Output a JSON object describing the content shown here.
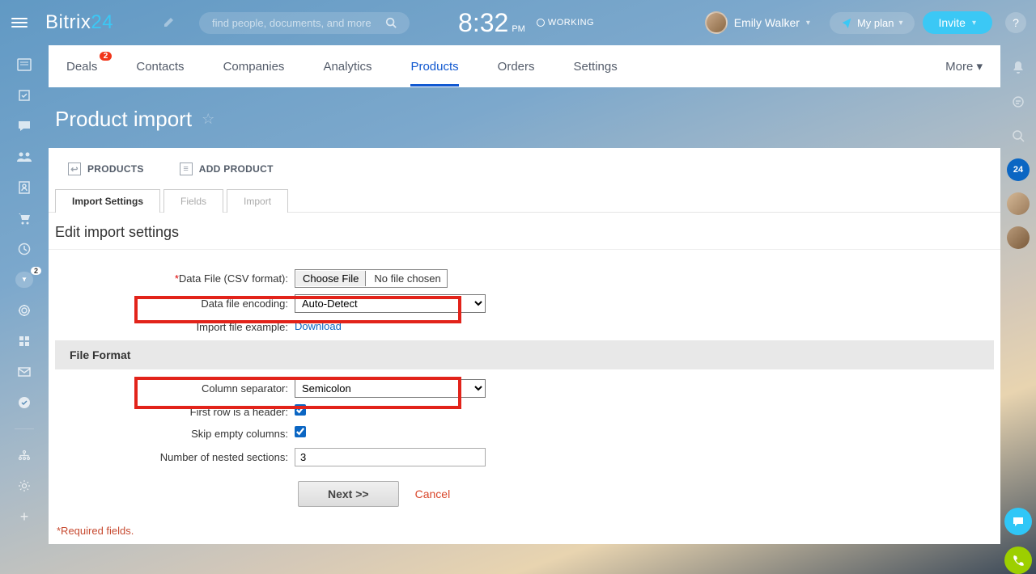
{
  "header": {
    "logo_main": "Bitrix",
    "logo_num": "24",
    "search_placeholder": "find people, documents, and more",
    "clock_time": "8:32",
    "clock_ampm": "PM",
    "working_label": "WORKING",
    "user_name": "Emily Walker",
    "myplan_label": "My plan",
    "invite_label": "Invite"
  },
  "tabs": {
    "deals": "Deals",
    "deals_badge": "2",
    "contacts": "Contacts",
    "companies": "Companies",
    "analytics": "Analytics",
    "products": "Products",
    "orders": "Orders",
    "settings": "Settings",
    "more": "More"
  },
  "page": {
    "title": "Product import"
  },
  "actions": {
    "products": "PRODUCTS",
    "add_product": "ADD PRODUCT"
  },
  "wizard": {
    "import_settings": "Import Settings",
    "fields": "Fields",
    "import": "Import"
  },
  "section": {
    "heading": "Edit import settings",
    "file_format": "File Format"
  },
  "form": {
    "data_file_label": "Data File (CSV format):",
    "choose_file": "Choose File",
    "no_file": "No file chosen",
    "encoding_label": "Data file encoding:",
    "encoding_value": "Auto-Detect",
    "example_label": "Import file example:",
    "download": "Download",
    "separator_label": "Column separator:",
    "separator_value": "Semicolon",
    "first_row_label": "First row is a header:",
    "skip_empty_label": "Skip empty columns:",
    "nested_label": "Number of nested sections:",
    "nested_value": "3",
    "next": "Next >>",
    "cancel": "Cancel",
    "required_note": "*Required fields."
  },
  "left_sidebar": {
    "funnel_badge": "2"
  },
  "right_sidebar": {
    "b24": "24"
  }
}
